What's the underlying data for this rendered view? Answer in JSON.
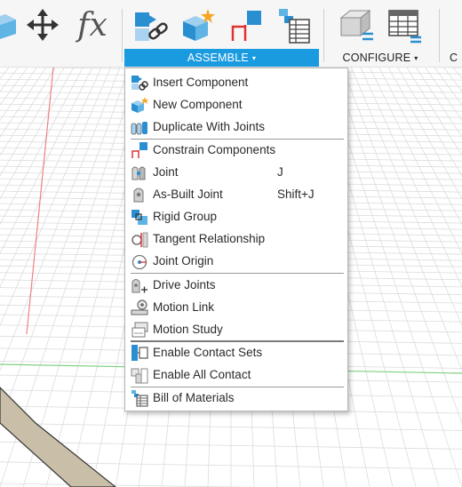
{
  "toolbar": {
    "icons": [
      "component-icon",
      "move-icon",
      "parameters-fx-icon",
      "insert-component-icon",
      "new-component-icon",
      "constrain-components-icon",
      "bill-of-materials-icon",
      "configure-box-icon",
      "configure-table-icon"
    ],
    "fx_text": "fx",
    "assemble_label": "ASSEMBLE",
    "configure_label": "CONFIGURE",
    "partial_label": "C",
    "caret": "▾",
    "accent_color": "#1a9be0"
  },
  "menu": {
    "items": [
      {
        "label": "Insert Component",
        "shortcut": "",
        "icon": "insert-component-icon"
      },
      {
        "label": "New Component",
        "shortcut": "",
        "icon": "new-component-icon"
      },
      {
        "label": "Duplicate With Joints",
        "shortcut": "",
        "icon": "duplicate-joints-icon"
      },
      {
        "label": "Constrain Components",
        "shortcut": "",
        "icon": "constrain-components-icon"
      },
      {
        "label": "Joint",
        "shortcut": "J",
        "icon": "joint-icon"
      },
      {
        "label": "As-Built Joint",
        "shortcut": "Shift+J",
        "icon": "as-built-joint-icon"
      },
      {
        "label": "Rigid Group",
        "shortcut": "",
        "icon": "rigid-group-icon"
      },
      {
        "label": "Tangent Relationship",
        "shortcut": "",
        "icon": "tangent-relationship-icon"
      },
      {
        "label": "Joint Origin",
        "shortcut": "",
        "icon": "joint-origin-icon"
      },
      {
        "label": "Drive Joints",
        "shortcut": "",
        "icon": "drive-joints-icon"
      },
      {
        "label": "Motion Link",
        "shortcut": "",
        "icon": "motion-link-icon"
      },
      {
        "label": "Motion Study",
        "shortcut": "",
        "icon": "motion-study-icon"
      },
      {
        "label": "Enable Contact Sets",
        "shortcut": "",
        "icon": "enable-contact-sets-icon"
      },
      {
        "label": "Enable All Contact",
        "shortcut": "",
        "icon": "enable-all-contact-icon"
      },
      {
        "label": "Bill of Materials",
        "shortcut": "",
        "icon": "bill-of-materials-icon"
      }
    ]
  }
}
